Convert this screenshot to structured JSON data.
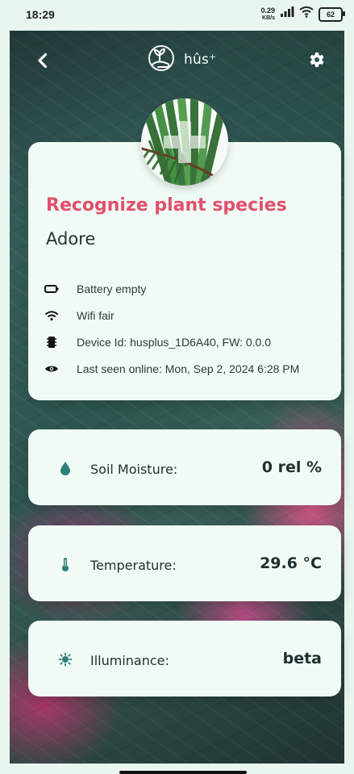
{
  "status": {
    "time": "18:29",
    "speed_value": "0.29",
    "speed_unit": "KB/s",
    "battery_level": "62"
  },
  "header": {
    "brand": "hûs⁺"
  },
  "device": {
    "title": "Recognize plant species",
    "name": "Adore",
    "info": [
      {
        "icon": "battery-icon",
        "text": "Battery empty"
      },
      {
        "icon": "wifi-icon",
        "text": "Wifi fair"
      },
      {
        "icon": "chip-icon",
        "text": "Device Id: husplus_1D6A40, FW: 0.0.0"
      },
      {
        "icon": "eye-icon",
        "text": "Last seen online: Mon, Sep 2, 2024 6:28 PM"
      }
    ]
  },
  "metrics": [
    {
      "icon": "water-drop-icon",
      "label": "Soil Moisture:",
      "value": "0 rel %"
    },
    {
      "icon": "thermometer-icon",
      "label": "Temperature:",
      "value": "29.6 °C"
    },
    {
      "icon": "sun-icon",
      "label": "Illuminance:",
      "value": "beta"
    }
  ],
  "colors": {
    "accent": "#E0506B",
    "teal": "#2E7F79",
    "card": "#F0FBF6"
  }
}
